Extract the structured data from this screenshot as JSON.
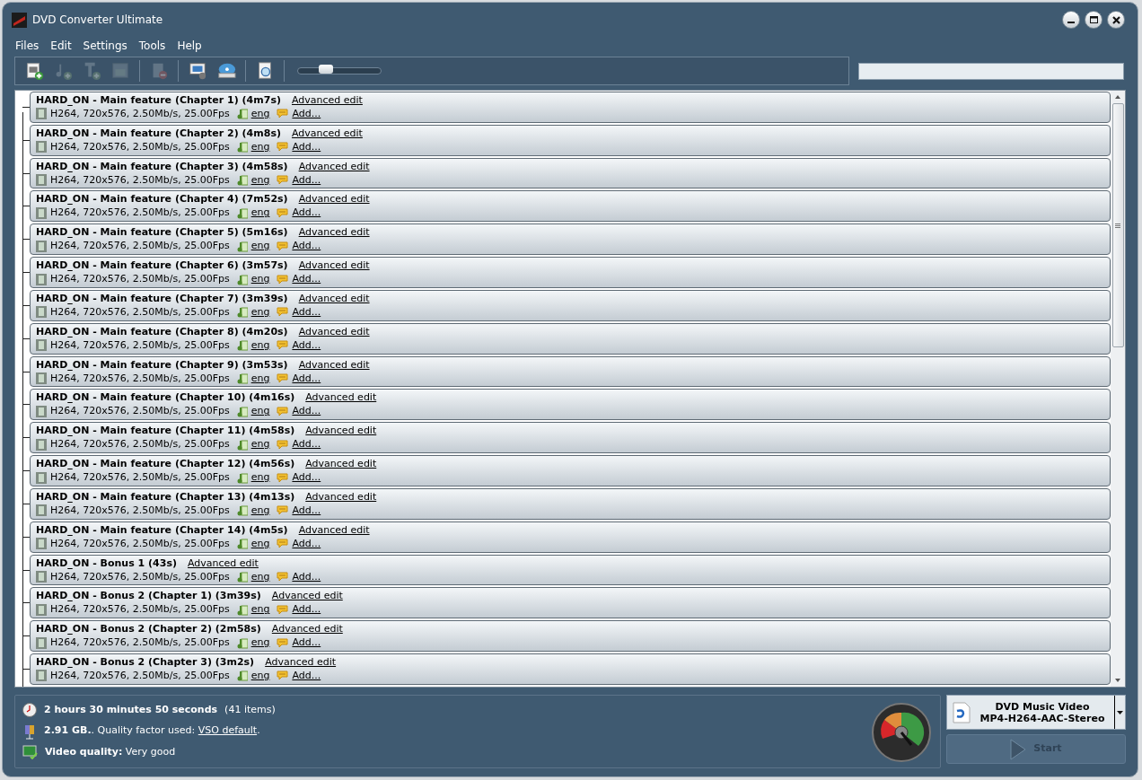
{
  "window": {
    "title": "DVD Converter Ultimate"
  },
  "menu": [
    "Files",
    "Edit",
    "Settings",
    "Tools",
    "Help"
  ],
  "toolbar": {
    "buttons": [
      {
        "kind": "add-video",
        "disabled": false
      },
      {
        "kind": "add-audio",
        "disabled": true
      },
      {
        "kind": "add-subtitle",
        "disabled": true
      },
      {
        "kind": "menu",
        "disabled": true
      },
      {
        "kind": "separator"
      },
      {
        "kind": "remove",
        "disabled": true
      },
      {
        "kind": "separator"
      },
      {
        "kind": "settings",
        "disabled": false
      },
      {
        "kind": "burn",
        "disabled": false
      },
      {
        "kind": "separator"
      },
      {
        "kind": "preview",
        "disabled": false
      },
      {
        "kind": "separator"
      }
    ],
    "slider": {
      "level": 0.3
    }
  },
  "titles": [
    {
      "title": "HARD_ON - Main feature (Chapter 1) (4m7s)",
      "edit": "Advanced edit",
      "video": "H264, 720x576, 2.50Mb/s, 25.00Fps",
      "audio": "eng",
      "subtitle": "Add..."
    },
    {
      "title": "HARD_ON - Main feature (Chapter 2) (4m8s)",
      "edit": "Advanced edit",
      "video": "H264, 720x576, 2.50Mb/s, 25.00Fps",
      "audio": "eng",
      "subtitle": "Add..."
    },
    {
      "title": "HARD_ON - Main feature (Chapter 3) (4m58s)",
      "edit": "Advanced edit",
      "video": "H264, 720x576, 2.50Mb/s, 25.00Fps",
      "audio": "eng",
      "subtitle": "Add..."
    },
    {
      "title": "HARD_ON - Main feature (Chapter 4) (7m52s)",
      "edit": "Advanced edit",
      "video": "H264, 720x576, 2.50Mb/s, 25.00Fps",
      "audio": "eng",
      "subtitle": "Add..."
    },
    {
      "title": "HARD_ON - Main feature (Chapter 5) (5m16s)",
      "edit": "Advanced edit",
      "video": "H264, 720x576, 2.50Mb/s, 25.00Fps",
      "audio": "eng",
      "subtitle": "Add..."
    },
    {
      "title": "HARD_ON - Main feature (Chapter 6) (3m57s)",
      "edit": "Advanced edit",
      "video": "H264, 720x576, 2.50Mb/s, 25.00Fps",
      "audio": "eng",
      "subtitle": "Add..."
    },
    {
      "title": "HARD_ON - Main feature (Chapter 7) (3m39s)",
      "edit": "Advanced edit",
      "video": "H264, 720x576, 2.50Mb/s, 25.00Fps",
      "audio": "eng",
      "subtitle": "Add..."
    },
    {
      "title": "HARD_ON - Main feature (Chapter 8) (4m20s)",
      "edit": "Advanced edit",
      "video": "H264, 720x576, 2.50Mb/s, 25.00Fps",
      "audio": "eng",
      "subtitle": "Add..."
    },
    {
      "title": "HARD_ON - Main feature (Chapter 9) (3m53s)",
      "edit": "Advanced edit",
      "video": "H264, 720x576, 2.50Mb/s, 25.00Fps",
      "audio": "eng",
      "subtitle": "Add..."
    },
    {
      "title": "HARD_ON - Main feature (Chapter 10) (4m16s)",
      "edit": "Advanced edit",
      "video": "H264, 720x576, 2.50Mb/s, 25.00Fps",
      "audio": "eng",
      "subtitle": "Add..."
    },
    {
      "title": "HARD_ON - Main feature (Chapter 11) (4m58s)",
      "edit": "Advanced edit",
      "video": "H264, 720x576, 2.50Mb/s, 25.00Fps",
      "audio": "eng",
      "subtitle": "Add..."
    },
    {
      "title": "HARD_ON - Main feature (Chapter 12) (4m56s)",
      "edit": "Advanced edit",
      "video": "H264, 720x576, 2.50Mb/s, 25.00Fps",
      "audio": "eng",
      "subtitle": "Add..."
    },
    {
      "title": "HARD_ON - Main feature (Chapter 13) (4m13s)",
      "edit": "Advanced edit",
      "video": "H264, 720x576, 2.50Mb/s, 25.00Fps",
      "audio": "eng",
      "subtitle": "Add..."
    },
    {
      "title": "HARD_ON - Main feature (Chapter 14) (4m5s)",
      "edit": "Advanced edit",
      "video": "H264, 720x576, 2.50Mb/s, 25.00Fps",
      "audio": "eng",
      "subtitle": "Add..."
    },
    {
      "title": "HARD_ON - Bonus 1 (43s)",
      "edit": "Advanced edit",
      "video": "H264, 720x576, 2.50Mb/s, 25.00Fps",
      "audio": "eng",
      "subtitle": "Add..."
    },
    {
      "title": "HARD_ON - Bonus 2 (Chapter 1) (3m39s)",
      "edit": "Advanced edit",
      "video": "H264, 720x576, 2.50Mb/s, 25.00Fps",
      "audio": "eng",
      "subtitle": "Add..."
    },
    {
      "title": "HARD_ON - Bonus 2 (Chapter 2) (2m58s)",
      "edit": "Advanced edit",
      "video": "H264, 720x576, 2.50Mb/s, 25.00Fps",
      "audio": "eng",
      "subtitle": "Add..."
    },
    {
      "title": "HARD_ON - Bonus 2 (Chapter 3) (3m2s)",
      "edit": "Advanced edit",
      "video": "H264, 720x576, 2.50Mb/s, 25.00Fps",
      "audio": "eng",
      "subtitle": "Add..."
    }
  ],
  "summary": {
    "duration": "2 hours 30 minutes 50 seconds",
    "items": "(41 items)",
    "size": "2.91 GB.",
    "quality_factor": ". Quality factor used:",
    "quality_link": "VSO default",
    "quality_end": ".",
    "video_quality_label": "Video quality:",
    "video_quality": "Very good"
  },
  "profile": {
    "line_1": "DVD Music Video",
    "line_2": "MP4-H264-AAC-Stereo"
  },
  "start_button": {
    "label": "Start",
    "disabled": true
  }
}
